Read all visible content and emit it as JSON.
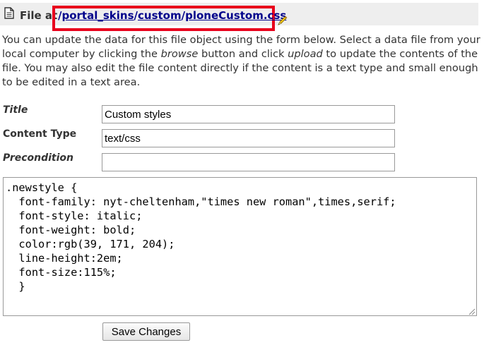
{
  "header": {
    "title_prefix": "File at",
    "path_sep": "/",
    "path_parts": [
      "portal_skins",
      "custom"
    ],
    "file_name": "ploneCustom.css"
  },
  "intro": {
    "part1": "You can update the data for this file object using the form below. Select a data file from your local computer by clicking the ",
    "browse": "browse",
    "part2": " button and click ",
    "upload": "upload",
    "part3": " to update the contents of the file. You may also edit the file content directly if the content is a text type and small enough to be edited in a text area."
  },
  "form": {
    "title_label": "Title",
    "title_value": "Custom styles",
    "content_type_label": "Content Type",
    "content_type_value": "text/css",
    "precondition_label": "Precondition",
    "precondition_value": "",
    "content": ".newstyle {\n  font-family: nyt-cheltenham,\"times new roman\",times,serif;\n  font-style: italic;\n  font-weight: bold;\n  color:rgb(39, 171, 204);\n  line-height:2em;\n  font-size:115%;\n  }",
    "save_label": "Save Changes"
  },
  "colors": {
    "highlight_box": "#e8001c",
    "link": "#00008b",
    "title_bar_bg": "#eeeeee"
  },
  "icons": {
    "header_left": "file-icon",
    "header_right": "pencil-icon",
    "textarea_corner": "resize-grip-icon"
  }
}
